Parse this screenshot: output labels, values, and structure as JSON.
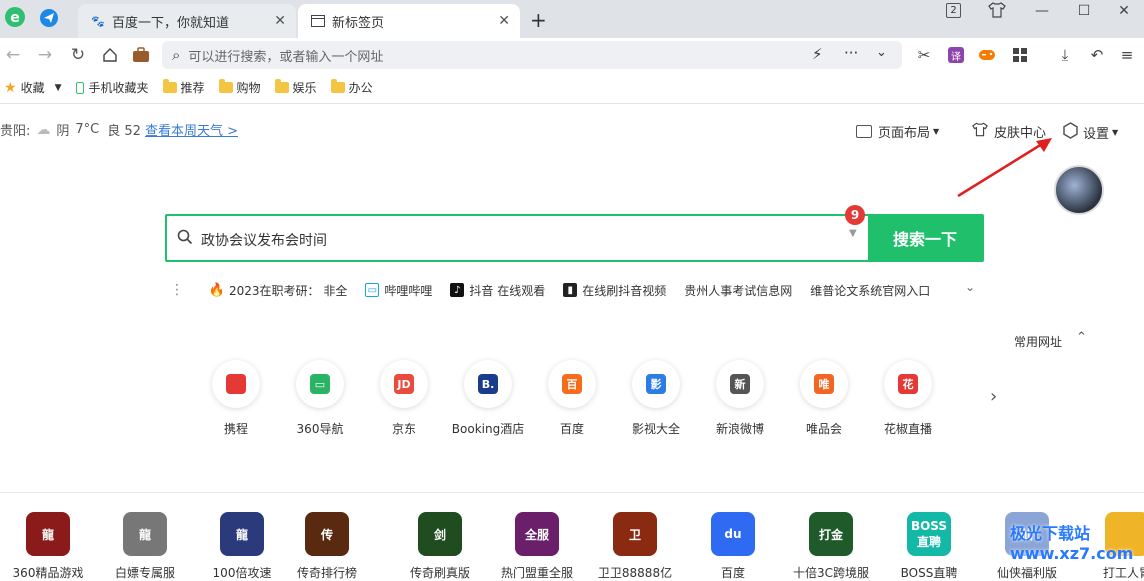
{
  "tabs": [
    {
      "title": "百度一下，你就知道"
    },
    {
      "title": "新标签页"
    }
  ],
  "window": {
    "badge_count": "2"
  },
  "address_bar": {
    "placeholder": "可以进行搜索，或者输入一个网址"
  },
  "bookmarks": [
    {
      "label": "收藏"
    },
    {
      "label": "手机收藏夹"
    },
    {
      "label": "推荐"
    },
    {
      "label": "购物"
    },
    {
      "label": "娱乐"
    },
    {
      "label": "办公"
    }
  ],
  "weather": {
    "city": "贵阳:",
    "condition": "阴",
    "temp": "7°C",
    "aqi": "良 52",
    "link": "查看本周天气 >"
  },
  "top_actions": {
    "layout": "页面布局",
    "skin": "皮肤中心",
    "settings": "设置"
  },
  "search": {
    "query": "政协会议发布会时间",
    "button": "搜索一下",
    "badge": "9"
  },
  "hot_items": [
    {
      "text": "2023在职考研：  非全"
    },
    {
      "text": "哔哩哔哩"
    },
    {
      "text": "抖音 在线观看"
    },
    {
      "text": "在线刷抖音视频"
    },
    {
      "text": "贵州人事考试信息网"
    },
    {
      "text": "维普论文系统官网入口"
    }
  ],
  "common_sites_label": "常用网址",
  "sites": [
    {
      "label": "携程",
      "glyph": "",
      "color": "#e53935"
    },
    {
      "label": "360导航",
      "glyph": "▭",
      "color": "#28b463"
    },
    {
      "label": "京东",
      "glyph": "JD",
      "color": "#e74c3c"
    },
    {
      "label": "Booking酒店",
      "glyph": "B.",
      "color": "#1a3c8c"
    },
    {
      "label": "百度",
      "glyph": "百",
      "color": "#f56c1d"
    },
    {
      "label": "影视大全",
      "glyph": "影",
      "color": "#2d7be5"
    },
    {
      "label": "新浪微博",
      "glyph": "新",
      "color": "#555"
    },
    {
      "label": "唯品会",
      "glyph": "唯",
      "color": "#f26522"
    },
    {
      "label": "花椒直播",
      "glyph": "花",
      "color": "#e53935"
    }
  ],
  "games": [
    {
      "label": "360精品游戏",
      "glyph": "龍",
      "color": "#8b1a1a"
    },
    {
      "label": "白嫖专属服",
      "glyph": "龍",
      "color": "#777"
    },
    {
      "label": "100倍攻速",
      "glyph": "龍",
      "color": "#2a3a7a"
    },
    {
      "label": "传奇排行榜",
      "glyph": "传",
      "color": "#5a2a10"
    },
    {
      "label": "传奇刷真版",
      "glyph": "剑",
      "color": "#1f4d1f"
    },
    {
      "label": "热门盟重全服",
      "glyph": "全服",
      "color": "#6b1f6b"
    },
    {
      "label": "卫卫88888亿",
      "glyph": "卫",
      "color": "#8a2a10"
    },
    {
      "label": "百度",
      "glyph": "du",
      "color": "#2e6bf2"
    },
    {
      "label": "十倍3C跨境服",
      "glyph": "打金",
      "color": "#1f5a2a"
    },
    {
      "label": "BOSS直聘",
      "glyph": "BOSS 直聘",
      "color": "#14b8a6"
    },
    {
      "label": "仙侠福利版",
      "glyph": "仙",
      "color": "#8ba6d6"
    },
    {
      "label": "打工人胃",
      "glyph": "",
      "color": "#f0b429"
    }
  ],
  "watermark": "极光下载站 www.xz7.com"
}
